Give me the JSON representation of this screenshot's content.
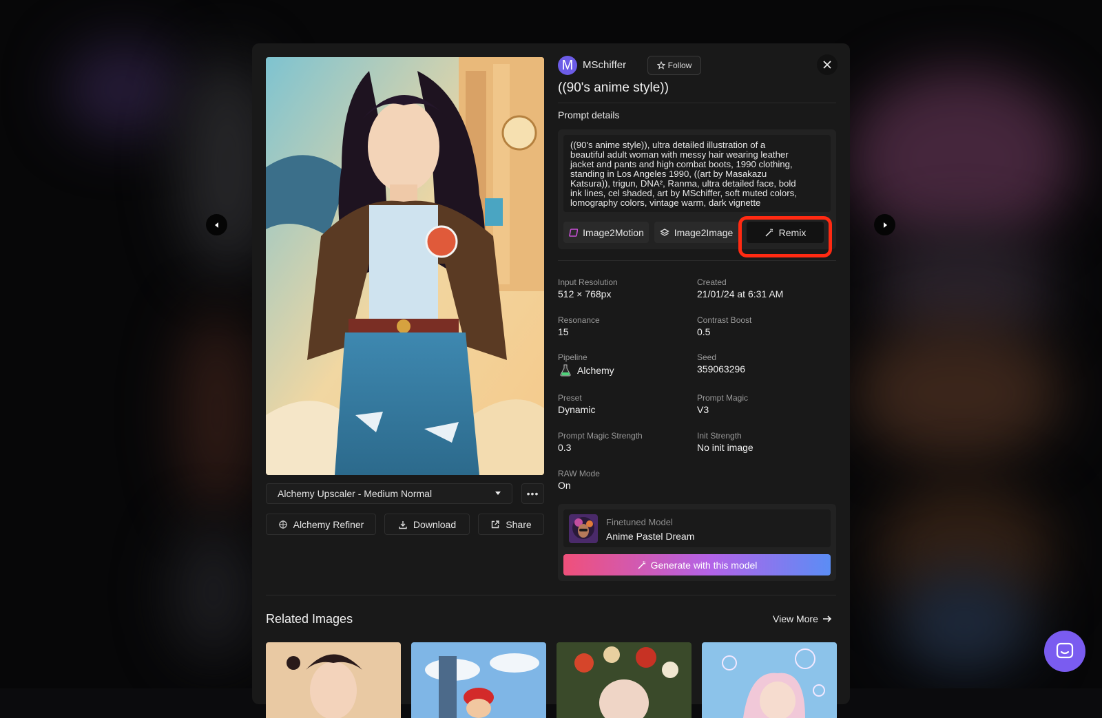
{
  "author": {
    "initial": "M",
    "name": "MSchiffer",
    "follow_label": "Follow",
    "avatar_color": "#6c5ce7"
  },
  "image_title": "((90's anime style))",
  "prompt": {
    "label": "Prompt details",
    "lines": [
      "((90's anime style)), ultra detailed illustration of a",
      "beautiful adult woman with messy hair wearing leather",
      "jacket and pants and high combat boots, 1990 clothing,",
      "standing in Los Angeles 1990, ((art by Masakazu",
      "Katsura)), trigun, DNA², Ranma, ultra detailed face, bold",
      "ink lines, cel shaded, art by MSchiffer, soft muted colors,",
      "lomography colors, vintage warm, dark vignette"
    ]
  },
  "tools": {
    "image2motion": "Image2Motion",
    "image2image": "Image2Image",
    "remix": "Remix"
  },
  "details": {
    "input_resolution": {
      "label": "Input Resolution",
      "value": "512 × 768px"
    },
    "created": {
      "label": "Created",
      "value": "21/01/24 at 6:31 AM"
    },
    "resonance": {
      "label": "Resonance",
      "value": "15"
    },
    "contrast_boost": {
      "label": "Contrast Boost",
      "value": "0.5"
    },
    "pipeline": {
      "label": "Pipeline",
      "value": "Alchemy"
    },
    "seed": {
      "label": "Seed",
      "value": "359063296"
    },
    "preset": {
      "label": "Preset",
      "value": "Dynamic"
    },
    "prompt_magic": {
      "label": "Prompt Magic",
      "value": "V3"
    },
    "prompt_magic_strength": {
      "label": "Prompt Magic Strength",
      "value": "0.3"
    },
    "init_strength": {
      "label": "Init Strength",
      "value": "No init image"
    },
    "raw_mode": {
      "label": "RAW Mode",
      "value": "On"
    }
  },
  "model": {
    "label": "Finetuned Model",
    "name": "Anime Pastel Dream",
    "generate_label": "Generate with this model"
  },
  "image_actions": {
    "upscaler_selected": "Alchemy Upscaler - Medium Normal",
    "refiner": "Alchemy Refiner",
    "download": "Download",
    "share": "Share"
  },
  "related": {
    "title": "Related Images",
    "view_more": "View More"
  },
  "colors": {
    "highlight": "#ff2a12",
    "accent_purple": "#7a5cf0",
    "gradient_start": "#f0507a",
    "gradient_end": "#5b8df5"
  }
}
